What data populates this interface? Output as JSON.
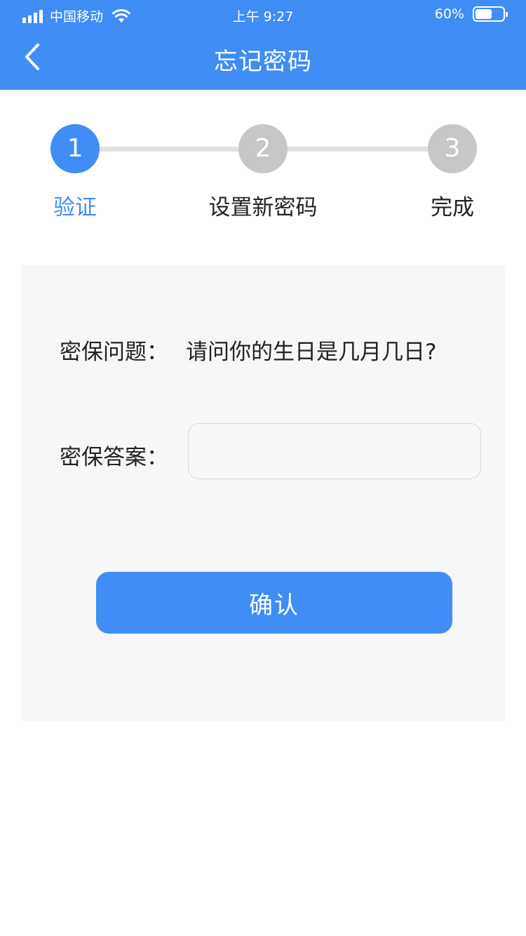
{
  "status_bar": {
    "carrier": "中国移动",
    "time": "上午 9:27",
    "battery": "60%",
    "battery_level": 0.6,
    "signal_icon": "signal-bars-icon",
    "wifi_icon": "wifi-icon",
    "battery_icon": "battery-icon"
  },
  "nav": {
    "title": "忘记密码",
    "back_icon": "chevron-left-icon"
  },
  "steps": [
    {
      "number": "1",
      "label": "验证",
      "active": true
    },
    {
      "number": "2",
      "label": "设置新密码",
      "active": false
    },
    {
      "number": "3",
      "label": "完成",
      "active": false
    }
  ],
  "form": {
    "question_label": "密保问题：",
    "question_text": "请问你的生日是几月几日?",
    "answer_label": "密保答案：",
    "answer_value": "",
    "answer_placeholder": "",
    "confirm_label": "确认"
  },
  "colors": {
    "primary": "#3f8df5",
    "step_inactive": "#c7c7c7",
    "card_bg": "#f7f7f7"
  }
}
